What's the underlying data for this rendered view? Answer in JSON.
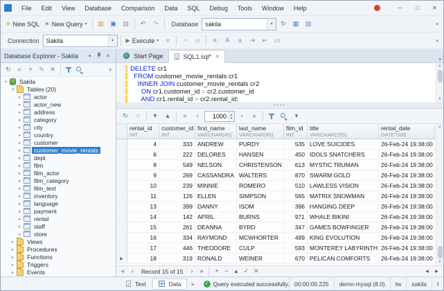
{
  "window": {
    "menu": [
      "File",
      "Edit",
      "View",
      "Database",
      "Comparison",
      "Data",
      "SQL",
      "Debug",
      "Tools",
      "Window",
      "Help"
    ],
    "controls": {
      "minimize": "─",
      "maximize": "□",
      "close": "✕"
    }
  },
  "icons": {
    "new_doc": "∗",
    "dropdown": "▾",
    "play": "▶",
    "close": "✕",
    "ok": "✓",
    "grip": "••••",
    "scroll_up": "▲",
    "scroll_down": "▼",
    "current_row": "▶"
  },
  "toolbar1": {
    "new_sql_label": "New SQL",
    "new_query_label": "New Query",
    "database_label": "Database",
    "database_value": "sakila",
    "icons_a": [
      {
        "sep": true
      },
      {
        "name": "open-file-icon",
        "glyph": "▨",
        "color": "#c9a227"
      },
      {
        "name": "save-icon",
        "glyph": "▣",
        "color": "#4a7fb5"
      },
      {
        "name": "print-icon",
        "glyph": "▤",
        "color": "#8a97a5"
      },
      {
        "sep": true
      },
      {
        "name": "undo-icon",
        "glyph": "↶",
        "color": "#3a7bd5"
      },
      {
        "name": "redo-icon",
        "glyph": "↷",
        "color": "#9aa7b5"
      },
      {
        "sep": true
      }
    ],
    "icons_b": [
      {
        "name": "refresh-schema-icon",
        "glyph": "↻",
        "color": "#3a9e4e"
      },
      {
        "name": "table-designer-icon",
        "glyph": "▦",
        "color": "#5b8abf"
      },
      {
        "name": "query-builder-icon",
        "glyph": "▧",
        "color": "#5b8abf"
      }
    ]
  },
  "toolbar2": {
    "connection_label": "Connection",
    "connection_value": "Sakila",
    "execute_label": "Execute",
    "icons_b": [
      {
        "name": "stop-icon",
        "glyph": "■",
        "color": "#c4ccd6"
      },
      {
        "sep": true
      },
      {
        "name": "query-profiler-icon",
        "glyph": "◔",
        "color": "#5b8abf"
      },
      {
        "name": "explain-plan-icon",
        "glyph": "▱",
        "color": "#8a97a5"
      },
      {
        "sep": true
      },
      {
        "name": "format-sql-icon",
        "glyph": "≡",
        "color": "#5b8abf"
      },
      {
        "name": "uppercase-keywords-icon",
        "glyph": "A",
        "color": "#5b8abf"
      },
      {
        "name": "lowercase-keywords-icon",
        "glyph": "a",
        "color": "#8a97a5"
      },
      {
        "name": "indent-icon",
        "glyph": "⇥",
        "color": "#8a97a5"
      },
      {
        "name": "outdent-icon",
        "glyph": "⇤",
        "color": "#8a97a5"
      },
      {
        "name": "comment-icon",
        "glyph": "▭",
        "color": "#8a97a5"
      }
    ]
  },
  "explorer": {
    "title": "Database Explorer - Sakila",
    "toolbar_icons": [
      {
        "name": "refresh-icon",
        "glyph": "↻",
        "color": "#3a9e4e"
      },
      {
        "name": "stop-refresh-icon",
        "glyph": "■",
        "color": "#c4ccd6"
      },
      {
        "name": "new-object-icon",
        "glyph": "+",
        "color": "#3a7bd5"
      },
      {
        "name": "edit-object-icon",
        "glyph": "✎",
        "color": "#8a97a5"
      },
      {
        "name": "delete-object-icon",
        "glyph": "✕",
        "color": "#b35c54"
      },
      {
        "sep": true
      },
      {
        "name": "filter-icon",
        "shape": "funnel"
      },
      {
        "name": "search-icon",
        "shape": "magnifier"
      }
    ],
    "root": "Sakila",
    "tables_group": "Tables (20)",
    "tables": [
      "actor",
      "actor_new",
      "address",
      "category",
      "city",
      "country",
      "customer",
      "customer_movie_rentals",
      "dept",
      "film",
      "film_actor",
      "film_category",
      "film_text",
      "inventory",
      "language",
      "payment",
      "rental",
      "staff",
      "store"
    ],
    "selected": "customer_movie_rentals",
    "groups": [
      "Views",
      "Procedures",
      "Functions",
      "Triggers",
      "Events"
    ]
  },
  "editor": {
    "tabs": [
      {
        "label": "Start Page"
      },
      {
        "label": "SQL1.sql*"
      }
    ],
    "lines": [
      [
        {
          "k": "kw",
          "v": "DELETE"
        },
        {
          "k": "id",
          "v": " cr1"
        }
      ],
      [
        {
          "k": "id",
          "v": "  "
        },
        {
          "k": "kw",
          "v": "FROM"
        },
        {
          "k": "id",
          "v": " customer_movie_rentals cr1"
        }
      ],
      [
        {
          "k": "id",
          "v": "    "
        },
        {
          "k": "kw",
          "v": "INNER JOIN"
        },
        {
          "k": "id",
          "v": " customer_movie_rentals cr2"
        }
      ],
      [
        {
          "k": "id",
          "v": "      "
        },
        {
          "k": "kw",
          "v": "ON"
        },
        {
          "k": "id",
          "v": " cr1.customer_id "
        },
        {
          "k": "op",
          "v": "="
        },
        {
          "k": "id",
          "v": " cr2.customer_id"
        }
      ],
      [
        {
          "k": "id",
          "v": "      "
        },
        {
          "k": "kw",
          "v": "AND"
        },
        {
          "k": "id",
          "v": " cr1.rental_id "
        },
        {
          "k": "op",
          "v": ">"
        },
        {
          "k": "id",
          "v": " cr2.rental_id;"
        }
      ]
    ]
  },
  "datatoolbar": {
    "page_size": "1000",
    "icons_a": [
      {
        "name": "refresh-data-icon",
        "glyph": "↻",
        "color": "#3a9e4e"
      },
      {
        "name": "cancel-refresh-icon",
        "glyph": "✕",
        "color": "#c4ccd6"
      },
      {
        "sep": true
      },
      {
        "name": "import-data-icon",
        "glyph": "▼",
        "color": "#5b8abf"
      },
      {
        "name": "export-data-icon",
        "glyph": "▲",
        "color": "#3a9e4e"
      },
      {
        "sep": true
      },
      {
        "name": "first-page-icon",
        "glyph": "«",
        "color": "#5a6b7d"
      },
      {
        "name": "prev-page-icon",
        "glyph": "‹",
        "color": "#5a6b7d"
      }
    ],
    "icons_b": [
      {
        "name": "next-page-icon",
        "glyph": "›",
        "color": "#5a6b7d"
      },
      {
        "name": "last-page-icon",
        "glyph": "»",
        "color": "#5a6b7d"
      },
      {
        "sep": true
      },
      {
        "name": "filter-data-icon",
        "shape": "funnel"
      },
      {
        "name": "search-data-icon",
        "shape": "magnifier"
      },
      {
        "name": "grid-options-icon",
        "glyph": "▾",
        "color": "#5a6b7d"
      }
    ]
  },
  "grid": {
    "columns": [
      {
        "name": "rental_id",
        "type": "INT",
        "align": "right"
      },
      {
        "name": "customer_id",
        "type": "INT",
        "align": "right"
      },
      {
        "name": "first_name",
        "type": "VARCHAR(45)",
        "align": "left"
      },
      {
        "name": "last_name",
        "type": "VARCHAR(45)",
        "align": "left"
      },
      {
        "name": "film_id",
        "type": "INT",
        "align": "right"
      },
      {
        "name": "title",
        "type": "VARCHAR(255)",
        "align": "left"
      },
      {
        "name": "rental_date",
        "type": "DATETIME",
        "align": "left"
      }
    ],
    "rows": [
      [
        4,
        333,
        "ANDREW",
        "PURDY",
        535,
        "LOVE SUICIDES",
        "26-Feb-24 19:38:00"
      ],
      [
        6,
        222,
        "DELORES",
        "HANSEN",
        450,
        "IDOLS SNATCHERS",
        "26-Feb-24 19:38:00"
      ],
      [
        8,
        549,
        "NELSON",
        "CHRISTENSON",
        613,
        "MYSTIC TRUMAN",
        "26-Feb-24 19:38:00"
      ],
      [
        9,
        269,
        "CASSANDRA",
        "WALTERS",
        870,
        "SWARM GOLD",
        "26-Feb-24 19:38:00"
      ],
      [
        10,
        239,
        "MINNIE",
        "ROMERO",
        510,
        "LAWLESS VISION",
        "26-Feb-24 19:38:00"
      ],
      [
        11,
        126,
        "ELLEN",
        "SIMPSON",
        565,
        "MATRIX SNOWMAN",
        "26-Feb-24 19:38:00"
      ],
      [
        13,
        399,
        "DANNY",
        "ISOM",
        396,
        "HANGING DEEP",
        "26-Feb-24 19:38:00"
      ],
      [
        14,
        142,
        "APRIL",
        "BURNS",
        971,
        "WHALE BIKINI",
        "26-Feb-24 19:38:00"
      ],
      [
        15,
        261,
        "DEANNA",
        "BYRD",
        347,
        "GAMES BOWFINGER",
        "26-Feb-24 19:38:00"
      ],
      [
        16,
        334,
        "RAYMOND",
        "MCWHORTER",
        499,
        "KING EVOLUTION",
        "26-Feb-24 19:38:00"
      ],
      [
        17,
        446,
        "THEODORE",
        "CULP",
        593,
        "MONTEREY LABYRINTH",
        "26-Feb-24 19:38:00"
      ],
      [
        18,
        319,
        "RONALD",
        "WEINER",
        670,
        "PELICAN COMFORTS",
        "26-Feb-24 19:38:00"
      ]
    ],
    "record_status": "Record 15 of 15",
    "nav_icons_left": [
      {
        "name": "first-record-icon",
        "glyph": "«"
      },
      {
        "name": "prev-record-icon",
        "glyph": "‹"
      }
    ],
    "nav_icons_right": [
      {
        "name": "next-record-icon",
        "glyph": "›"
      },
      {
        "name": "last-record-icon",
        "glyph": "»"
      },
      {
        "sep": true
      },
      {
        "name": "insert-record-icon",
        "glyph": "+"
      },
      {
        "name": "delete-record-icon",
        "glyph": "−"
      },
      {
        "name": "edit-record-icon",
        "glyph": "▴"
      },
      {
        "name": "post-edit-icon",
        "glyph": "✓",
        "color": "#3a9e4e"
      },
      {
        "name": "cancel-edit-icon",
        "glyph": "✕",
        "color": "#b35c54"
      }
    ],
    "hscroll_icons": [
      {
        "name": "scroll-left-icon",
        "glyph": "◂"
      },
      {
        "name": "scroll-right-icon",
        "glyph": "▸"
      }
    ]
  },
  "statusbar": {
    "tabs": [
      {
        "label": "Text"
      },
      {
        "label": "Data"
      }
    ],
    "add_tab": "+",
    "ok_icon": "✓",
    "message": "Query executed successfully.",
    "time": "00:00:00.225",
    "connection": "demo-mysql (8.0)",
    "user": "tw",
    "database": "sakila",
    "extra": "t"
  }
}
